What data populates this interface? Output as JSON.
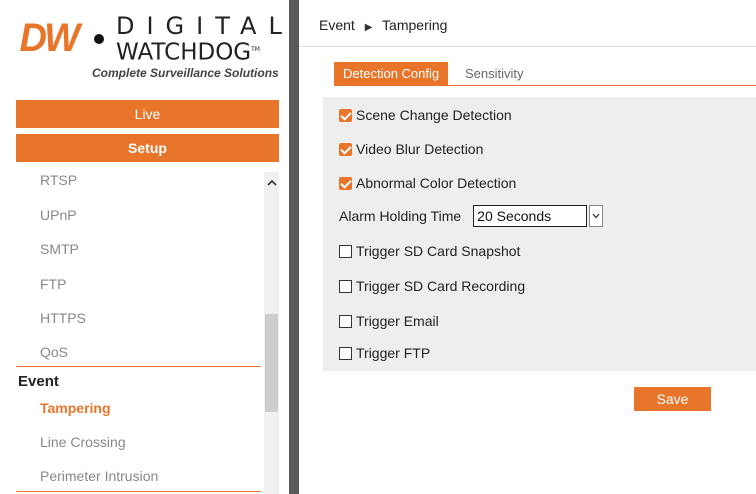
{
  "brand": {
    "dw": "DW",
    "line1": "DIGITAL",
    "line2": "WATCHDOG",
    "tm": "TM",
    "tagline": "Complete Surveillance Solutions",
    "accent_color": "#e8752a"
  },
  "nav": {
    "live_label": "Live",
    "setup_label": "Setup"
  },
  "sidebar": {
    "items": [
      "RTSP",
      "UPnP",
      "SMTP",
      "FTP",
      "HTTPS",
      "QoS"
    ],
    "group_event": "Event",
    "event_items": [
      "Tampering",
      "Line Crossing",
      "Perimeter Intrusion"
    ],
    "active_item": "Tampering",
    "scroll_up_icon": "chevron-up-icon"
  },
  "breadcrumb": {
    "section": "Event",
    "separator_icon": "triangle-right-icon",
    "page": "Tampering"
  },
  "tabs": {
    "active": "Detection Config",
    "inactive": "Sensitivity"
  },
  "form": {
    "scene_change": {
      "label": "Scene Change Detection",
      "checked": true
    },
    "video_blur": {
      "label": "Video Blur Detection",
      "checked": true
    },
    "abnormal_color": {
      "label": "Abnormal Color Detection",
      "checked": true
    },
    "alarm_holding": {
      "label": "Alarm Holding Time",
      "value": "20 Seconds"
    },
    "sd_snapshot": {
      "label": "Trigger SD Card Snapshot",
      "checked": false
    },
    "sd_recording": {
      "label": "Trigger SD Card Recording",
      "checked": false
    },
    "email": {
      "label": "Trigger Email",
      "checked": false
    },
    "ftp": {
      "label": "Trigger FTP",
      "checked": false
    }
  },
  "save_label": "Save"
}
